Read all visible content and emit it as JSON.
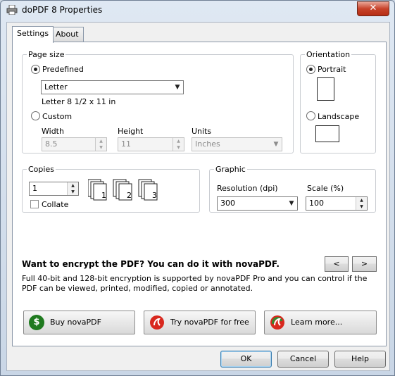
{
  "window": {
    "title": "doPDF 8 Properties",
    "close_glyph": "✕"
  },
  "tabs": [
    {
      "label": "Settings"
    },
    {
      "label": "About"
    }
  ],
  "page_size": {
    "group_label": "Page size",
    "predefined_label": "Predefined",
    "predefined_selected": true,
    "paper_value": "Letter",
    "paper_description": "Letter 8 1/2 x 11 in",
    "custom_label": "Custom",
    "width_label": "Width",
    "width_value": "8.5",
    "height_label": "Height",
    "height_value": "11",
    "units_label": "Units",
    "units_value": "Inches"
  },
  "orientation": {
    "group_label": "Orientation",
    "portrait_label": "Portrait",
    "landscape_label": "Landscape",
    "selected": "Portrait"
  },
  "copies": {
    "group_label": "Copies",
    "value": "1",
    "collate_label": "Collate",
    "collate_checked": false,
    "page_labels": [
      "1",
      "2",
      "3"
    ]
  },
  "graphic": {
    "group_label": "Graphic",
    "resolution_label": "Resolution (dpi)",
    "resolution_value": "300",
    "scale_label": "Scale (%)",
    "scale_value": "100"
  },
  "promo": {
    "headline": "Want to encrypt the PDF? You can do it with novaPDF.",
    "body": "Full 40-bit and 128-bit encryption is supported by novaPDF Pro and you can control if the PDF can be viewed, printed, modified, copied or annotated.",
    "prev_label": "<",
    "next_label": ">",
    "buy_label": "Buy novaPDF",
    "try_label": "Try novaPDF for free",
    "learn_label": "Learn more...",
    "buy_icon_glyph": "$"
  },
  "footer": {
    "ok_label": "OK",
    "cancel_label": "Cancel",
    "help_label": "Help"
  },
  "colors": {
    "dollar_icon": "#1f7a1f",
    "nova_icon": "#d8281e",
    "close_button": "#c7422a"
  },
  "icons": {
    "printer": "printer-icon",
    "portrait": "portrait-page-icon",
    "landscape": "landscape-page-icon"
  }
}
